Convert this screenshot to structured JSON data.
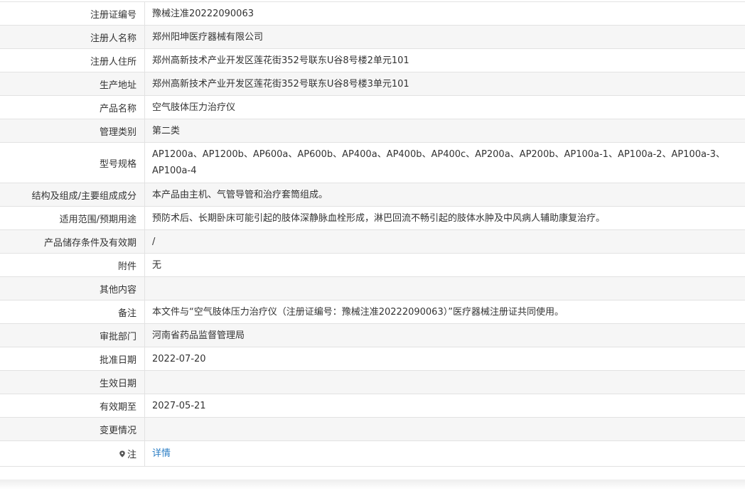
{
  "rows": [
    {
      "label": "注册证编号",
      "value": "豫械注准20222090063"
    },
    {
      "label": "注册人名称",
      "value": "郑州阳坤医疗器械有限公司"
    },
    {
      "label": "注册人住所",
      "value": "郑州高新技术产业开发区莲花街352号联东U谷8号楼2单元101"
    },
    {
      "label": "生产地址",
      "value": "郑州高新技术产业开发区莲花街352号联东U谷8号楼3单元101"
    },
    {
      "label": "产品名称",
      "value": "空气肢体压力治疗仪"
    },
    {
      "label": "管理类别",
      "value": "第二类"
    },
    {
      "label": "型号规格",
      "value": "AP1200a、AP1200b、AP600a、AP600b、AP400a、AP400b、AP400c、AP200a、AP200b、AP100a-1、AP100a-2、AP100a-3、AP100a-4"
    },
    {
      "label": "结构及组成/主要组成成分",
      "value": "本产品由主机、气管导管和治疗套筒组成。"
    },
    {
      "label": "适用范围/预期用途",
      "value": "预防术后、长期卧床可能引起的肢体深静脉血栓形成，淋巴回流不畅引起的肢体水肿及中风病人辅助康复治疗。"
    },
    {
      "label": "产品储存条件及有效期",
      "value": "/"
    },
    {
      "label": "附件",
      "value": "无"
    },
    {
      "label": "其他内容",
      "value": ""
    },
    {
      "label": "备注",
      "value": "本文件与“空气肢体压力治疗仪（注册证编号：豫械注准20222090063）”医疗器械注册证共同使用。"
    },
    {
      "label": "审批部门",
      "value": "河南省药品监督管理局"
    },
    {
      "label": "批准日期",
      "value": "2022-07-20"
    },
    {
      "label": "生效日期",
      "value": ""
    },
    {
      "label": "有效期至",
      "value": "2027-05-21"
    },
    {
      "label": "变更情况",
      "value": ""
    }
  ],
  "note": {
    "icon": "location-pin-icon",
    "label": "注",
    "link_text": "详情",
    "link_color": "#2b7ec4"
  }
}
